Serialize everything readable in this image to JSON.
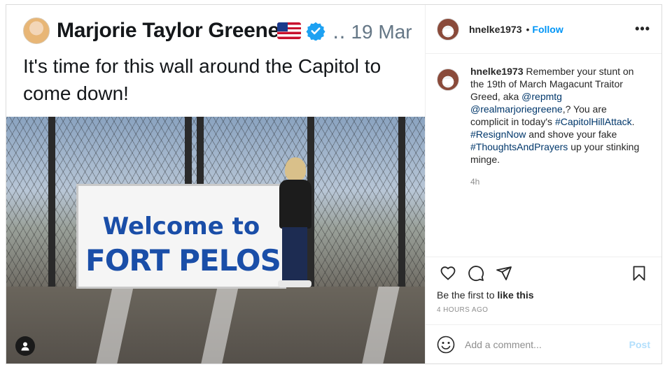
{
  "tweet": {
    "author": "Marjorie Taylor Greene",
    "date": "‥ 19 Mar",
    "text": "It's time for this wall around the Capitol to come down!",
    "sign_line1": "Welcome to",
    "sign_line2": "FORT PELOSI"
  },
  "post": {
    "username": "hnelke1973",
    "dot": "•",
    "follow_label": "Follow",
    "more_label": "•••"
  },
  "caption": {
    "username": "hnelke1973",
    "text_1": " Remember your stunt on the 19th of March Magacunt Traitor Greed, aka ",
    "mention_1": "@repmtg",
    "mention_2": "@realmarjoriegreene",
    "text_2": ",? You are complicit in today's ",
    "hashtag_1": "#CapitolHillAttack",
    "text_3": ". ",
    "hashtag_2": "#ResignNow",
    "text_4": " and shove your fake ",
    "hashtag_3": "#ThoughtsAndPrayers",
    "text_5": " up your stinking minge.",
    "time": "4h"
  },
  "likes": {
    "prefix": "Be the first to ",
    "action": "like this"
  },
  "posted_time": "4 HOURS AGO",
  "comment_box": {
    "placeholder": "Add a comment...",
    "post_label": "Post"
  },
  "colors": {
    "link_blue": "#0095f6",
    "hashtag": "#00376b",
    "post_disabled": "#b2dffc",
    "muted": "#8e8e8e"
  },
  "icons": [
    "flag-us-icon",
    "verified-icon",
    "user-tag-icon",
    "more-icon",
    "heart-icon",
    "comment-icon",
    "share-icon",
    "bookmark-icon",
    "emoji-icon"
  ]
}
